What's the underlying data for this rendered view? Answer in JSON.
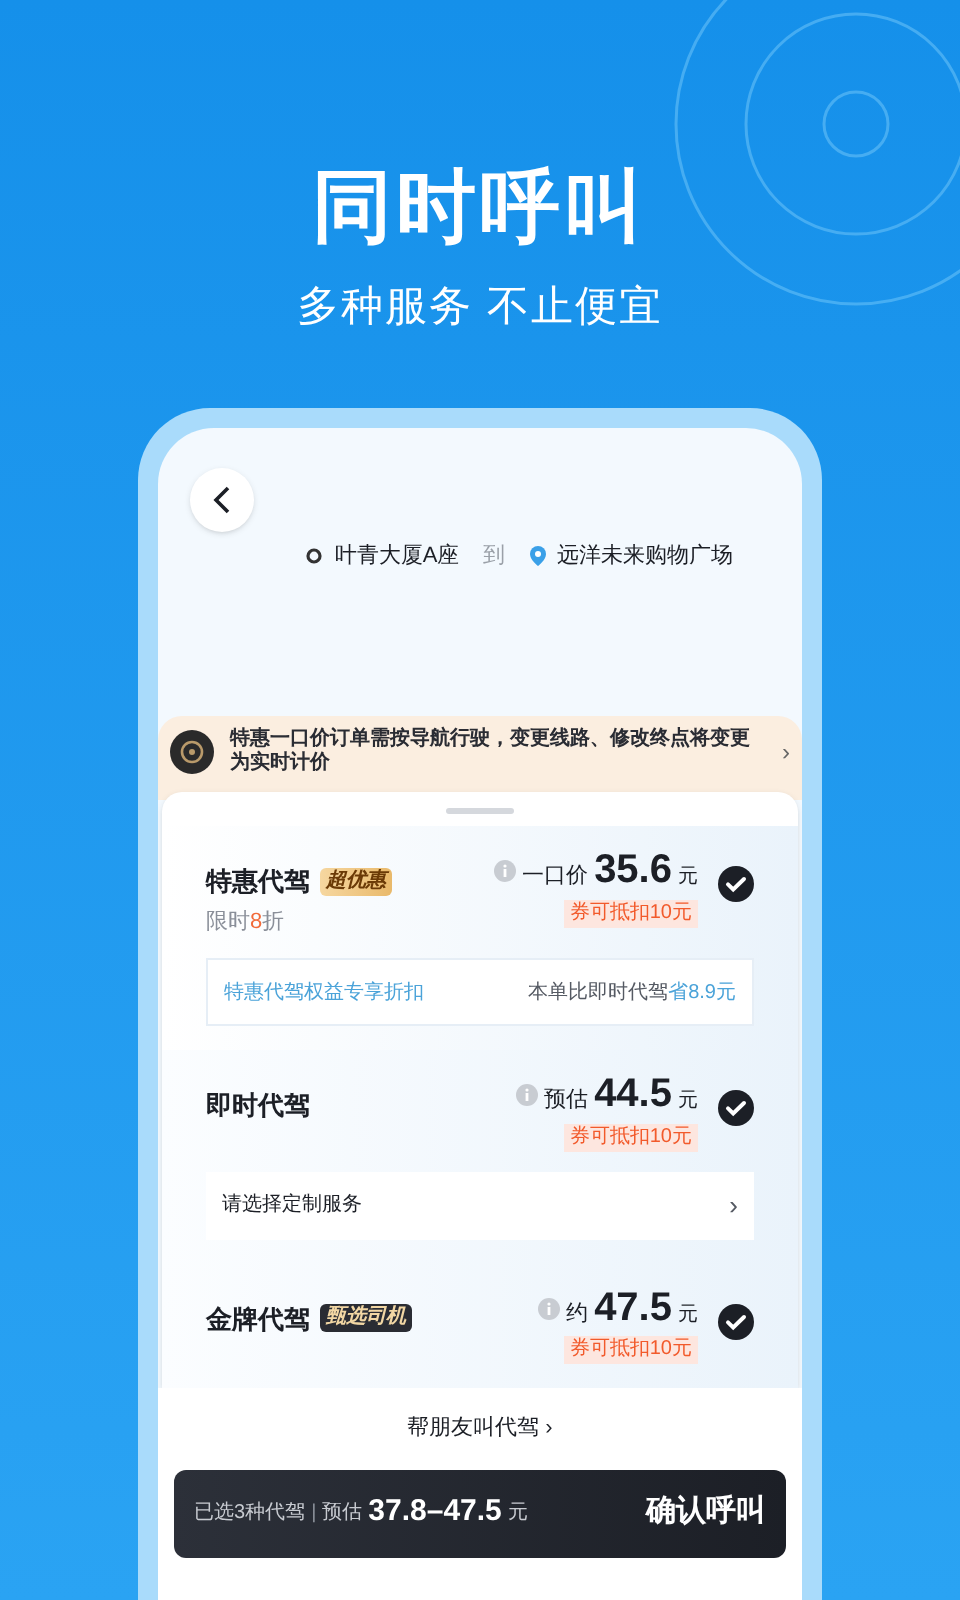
{
  "headline": "同时呼叫",
  "subtitle": "多种服务 不止便宜",
  "route": {
    "from": "叶青大厦A座",
    "connector": "到",
    "to": "远洋未来购物广场"
  },
  "notice": {
    "text": "特惠一口价订单需按导航行驶，变更线路、修改终点将变更为实时计价"
  },
  "options": [
    {
      "name": "特惠代驾",
      "tag": {
        "text": "超优惠",
        "kind": "gold"
      },
      "note": {
        "prefix": "限时",
        "highlight": "8",
        "suffix": "折"
      },
      "price_label": "一口价",
      "price": "35.6",
      "unit": "元",
      "coupon": "券可抵扣10元",
      "selected": true,
      "sub": {
        "kind": "promo",
        "left": "特惠代驾权益专享折扣",
        "right_prefix": "本单比即时代驾",
        "right_highlight": "省8.9元"
      }
    },
    {
      "name": "即时代驾",
      "price_label": "预估",
      "price": "44.5",
      "unit": "元",
      "coupon": "券可抵扣10元",
      "selected": true,
      "sub": {
        "kind": "link",
        "left": "请选择定制服务",
        "arrow": "›"
      }
    },
    {
      "name": "金牌代驾",
      "tag": {
        "text": "甄选司机",
        "kind": "dark"
      },
      "price_label": "约",
      "price": "47.5",
      "unit": "元",
      "coupon": "券可抵扣10元",
      "selected": true
    }
  ],
  "friend_link": "帮朋友叫代驾 ›",
  "summary": {
    "count": "已选3种代驾",
    "separator": "|",
    "estimate_label": "预估",
    "range": "37.8–47.5",
    "unit": "元",
    "confirm": "确认呼叫"
  }
}
